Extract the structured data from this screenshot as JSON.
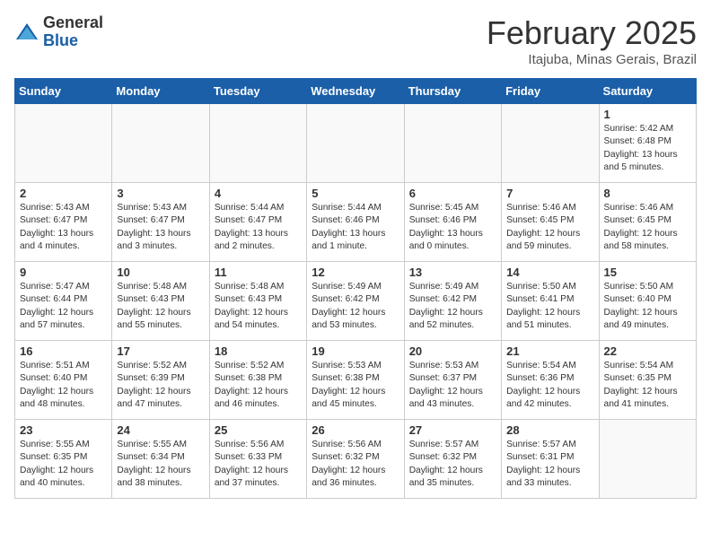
{
  "header": {
    "logo": {
      "general": "General",
      "blue": "Blue"
    },
    "title": "February 2025",
    "location": "Itajuba, Minas Gerais, Brazil"
  },
  "calendar": {
    "days_of_week": [
      "Sunday",
      "Monday",
      "Tuesday",
      "Wednesday",
      "Thursday",
      "Friday",
      "Saturday"
    ],
    "weeks": [
      [
        {
          "day": "",
          "info": ""
        },
        {
          "day": "",
          "info": ""
        },
        {
          "day": "",
          "info": ""
        },
        {
          "day": "",
          "info": ""
        },
        {
          "day": "",
          "info": ""
        },
        {
          "day": "",
          "info": ""
        },
        {
          "day": "1",
          "info": "Sunrise: 5:42 AM\nSunset: 6:48 PM\nDaylight: 13 hours\nand 5 minutes."
        }
      ],
      [
        {
          "day": "2",
          "info": "Sunrise: 5:43 AM\nSunset: 6:47 PM\nDaylight: 13 hours\nand 4 minutes."
        },
        {
          "day": "3",
          "info": "Sunrise: 5:43 AM\nSunset: 6:47 PM\nDaylight: 13 hours\nand 3 minutes."
        },
        {
          "day": "4",
          "info": "Sunrise: 5:44 AM\nSunset: 6:47 PM\nDaylight: 13 hours\nand 2 minutes."
        },
        {
          "day": "5",
          "info": "Sunrise: 5:44 AM\nSunset: 6:46 PM\nDaylight: 13 hours\nand 1 minute."
        },
        {
          "day": "6",
          "info": "Sunrise: 5:45 AM\nSunset: 6:46 PM\nDaylight: 13 hours\nand 0 minutes."
        },
        {
          "day": "7",
          "info": "Sunrise: 5:46 AM\nSunset: 6:45 PM\nDaylight: 12 hours\nand 59 minutes."
        },
        {
          "day": "8",
          "info": "Sunrise: 5:46 AM\nSunset: 6:45 PM\nDaylight: 12 hours\nand 58 minutes."
        }
      ],
      [
        {
          "day": "9",
          "info": "Sunrise: 5:47 AM\nSunset: 6:44 PM\nDaylight: 12 hours\nand 57 minutes."
        },
        {
          "day": "10",
          "info": "Sunrise: 5:48 AM\nSunset: 6:43 PM\nDaylight: 12 hours\nand 55 minutes."
        },
        {
          "day": "11",
          "info": "Sunrise: 5:48 AM\nSunset: 6:43 PM\nDaylight: 12 hours\nand 54 minutes."
        },
        {
          "day": "12",
          "info": "Sunrise: 5:49 AM\nSunset: 6:42 PM\nDaylight: 12 hours\nand 53 minutes."
        },
        {
          "day": "13",
          "info": "Sunrise: 5:49 AM\nSunset: 6:42 PM\nDaylight: 12 hours\nand 52 minutes."
        },
        {
          "day": "14",
          "info": "Sunrise: 5:50 AM\nSunset: 6:41 PM\nDaylight: 12 hours\nand 51 minutes."
        },
        {
          "day": "15",
          "info": "Sunrise: 5:50 AM\nSunset: 6:40 PM\nDaylight: 12 hours\nand 49 minutes."
        }
      ],
      [
        {
          "day": "16",
          "info": "Sunrise: 5:51 AM\nSunset: 6:40 PM\nDaylight: 12 hours\nand 48 minutes."
        },
        {
          "day": "17",
          "info": "Sunrise: 5:52 AM\nSunset: 6:39 PM\nDaylight: 12 hours\nand 47 minutes."
        },
        {
          "day": "18",
          "info": "Sunrise: 5:52 AM\nSunset: 6:38 PM\nDaylight: 12 hours\nand 46 minutes."
        },
        {
          "day": "19",
          "info": "Sunrise: 5:53 AM\nSunset: 6:38 PM\nDaylight: 12 hours\nand 45 minutes."
        },
        {
          "day": "20",
          "info": "Sunrise: 5:53 AM\nSunset: 6:37 PM\nDaylight: 12 hours\nand 43 minutes."
        },
        {
          "day": "21",
          "info": "Sunrise: 5:54 AM\nSunset: 6:36 PM\nDaylight: 12 hours\nand 42 minutes."
        },
        {
          "day": "22",
          "info": "Sunrise: 5:54 AM\nSunset: 6:35 PM\nDaylight: 12 hours\nand 41 minutes."
        }
      ],
      [
        {
          "day": "23",
          "info": "Sunrise: 5:55 AM\nSunset: 6:35 PM\nDaylight: 12 hours\nand 40 minutes."
        },
        {
          "day": "24",
          "info": "Sunrise: 5:55 AM\nSunset: 6:34 PM\nDaylight: 12 hours\nand 38 minutes."
        },
        {
          "day": "25",
          "info": "Sunrise: 5:56 AM\nSunset: 6:33 PM\nDaylight: 12 hours\nand 37 minutes."
        },
        {
          "day": "26",
          "info": "Sunrise: 5:56 AM\nSunset: 6:32 PM\nDaylight: 12 hours\nand 36 minutes."
        },
        {
          "day": "27",
          "info": "Sunrise: 5:57 AM\nSunset: 6:32 PM\nDaylight: 12 hours\nand 35 minutes."
        },
        {
          "day": "28",
          "info": "Sunrise: 5:57 AM\nSunset: 6:31 PM\nDaylight: 12 hours\nand 33 minutes."
        },
        {
          "day": "",
          "info": ""
        }
      ]
    ]
  }
}
